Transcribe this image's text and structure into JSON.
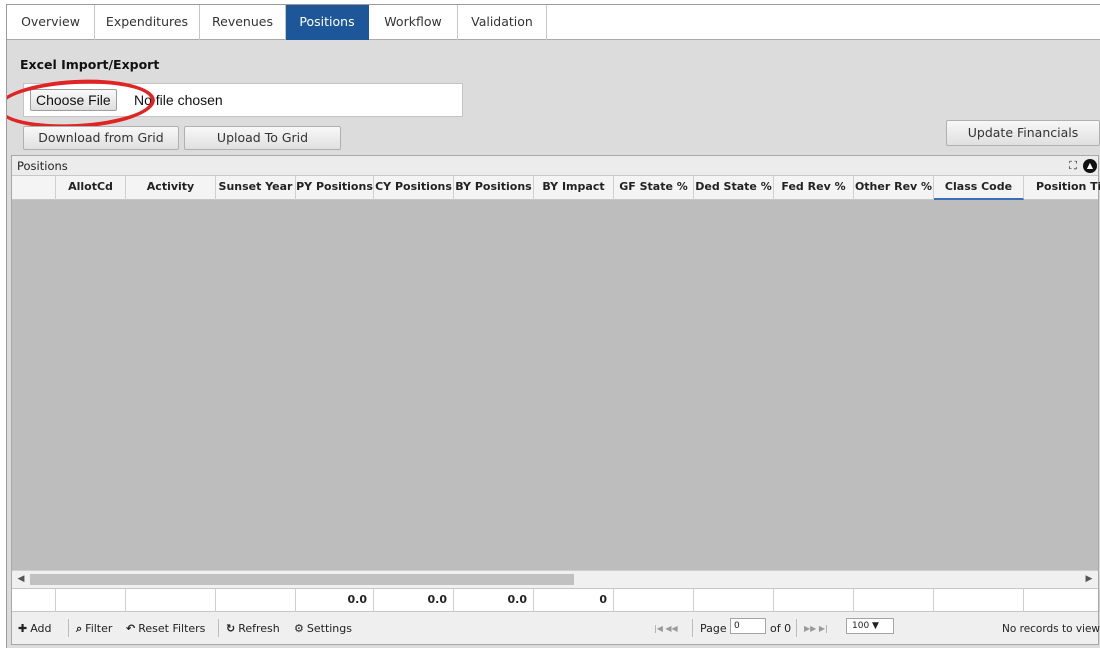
{
  "tabs": [
    {
      "label": "Overview",
      "active": false
    },
    {
      "label": "Expenditures",
      "active": false
    },
    {
      "label": "Revenues",
      "active": false
    },
    {
      "label": "Positions",
      "active": true
    },
    {
      "label": "Workflow",
      "active": false
    },
    {
      "label": "Validation",
      "active": false
    }
  ],
  "section": {
    "title": "Excel Import/Export"
  },
  "file_input": {
    "button_label": "Choose File",
    "status_text": "No file chosen"
  },
  "buttons": {
    "download": "Download from Grid",
    "upload": "Upload To Grid",
    "update_financials": "Update Financials"
  },
  "grid": {
    "caption": "Positions",
    "columns": [
      "",
      "AllotCd",
      "Activity",
      "Sunset Year",
      "PY Positions",
      "CY Positions",
      "BY Positions",
      "BY Impact",
      "GF State %",
      "Ded State %",
      "Fed Rev %",
      "Other Rev %",
      "Class Code",
      "Position Tit"
    ],
    "selected_column": "Class Code",
    "footer_values": [
      "",
      "",
      "",
      "",
      "0.0",
      "0.0",
      "0.0",
      "0",
      "",
      "",
      "",
      "",
      "",
      ""
    ]
  },
  "pager": {
    "add_label": "Add",
    "filter_label": "Filter",
    "reset_filters_label": "Reset Filters",
    "refresh_label": "Refresh",
    "settings_label": "Settings",
    "page_label": "Page",
    "page_value": "0",
    "of_label": "of 0",
    "rows_per_page": "100 ▼",
    "no_records": "No records to view"
  },
  "colors": {
    "active_tab": "#1e5799",
    "annotation": "#e02323",
    "grid_body": "#bdbdbd"
  }
}
